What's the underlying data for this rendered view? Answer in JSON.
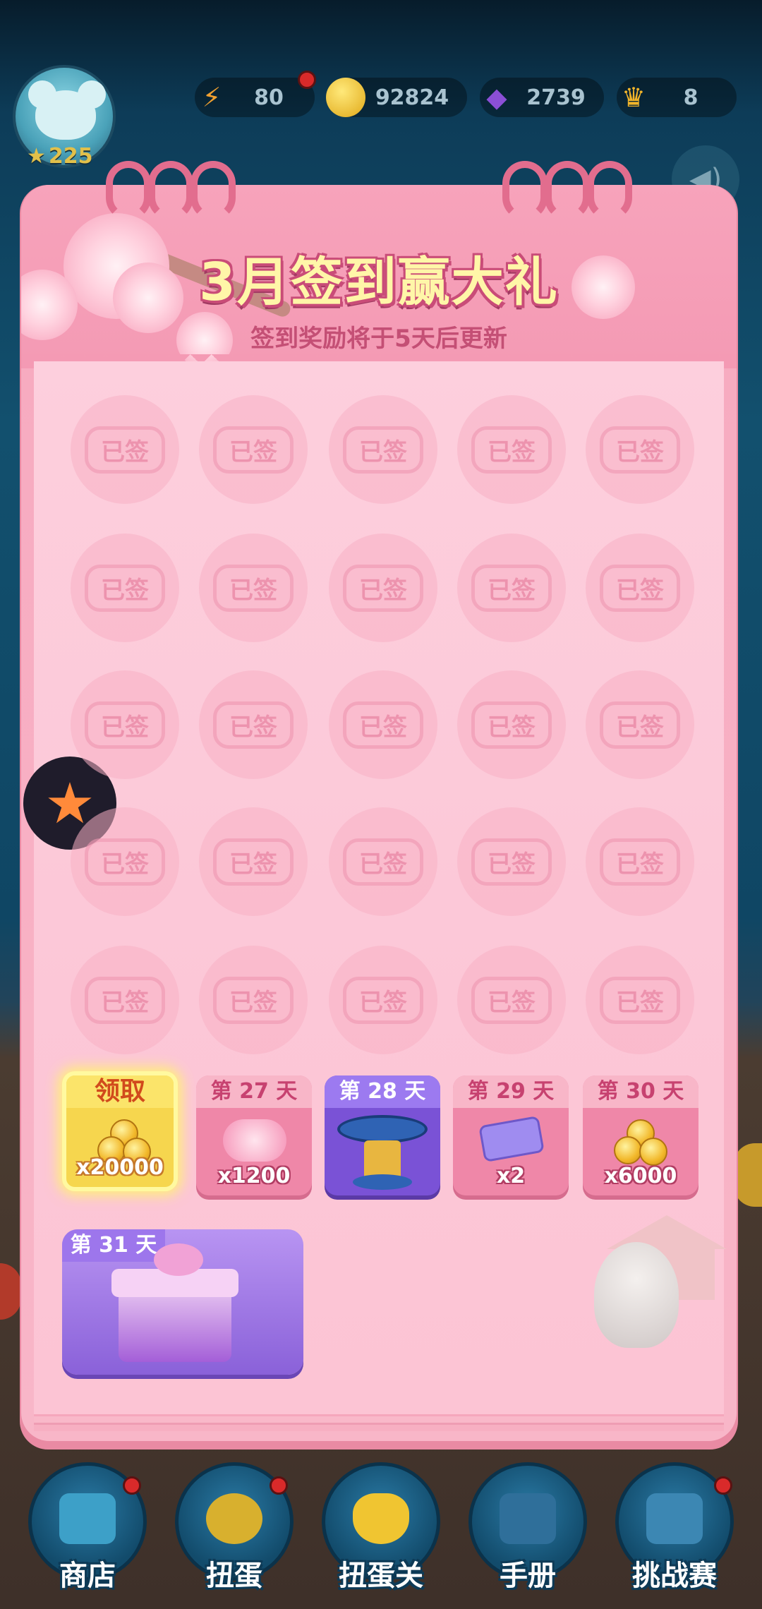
{
  "top_bar": {
    "player_stars": "225",
    "energy": "80",
    "coins": "92824",
    "gems": "2739",
    "crowns": "8"
  },
  "calendar": {
    "title": "3月签到赢大礼",
    "subtitle": "签到奖励将于5天后更新",
    "signed_label": "已签",
    "rewards": [
      {
        "label": "领取",
        "amount": "x20000",
        "icon": "coin-pile-icon"
      },
      {
        "label": "第 27 天",
        "amount": "x1200",
        "icon": "pink-cloud-icon"
      },
      {
        "label": "第 28 天",
        "amount": "",
        "icon": "pedestal-icon"
      },
      {
        "label": "第 29 天",
        "amount": "x2",
        "icon": "ticket-icon"
      },
      {
        "label": "第 30 天",
        "amount": "x6000",
        "icon": "coin-pile-icon"
      }
    ],
    "final_reward": {
      "label": "第 31 天",
      "icon": "gift-box-icon"
    }
  },
  "bottom_nav": [
    {
      "label": "商店",
      "icon": "shop-icon"
    },
    {
      "label": "扭蛋",
      "icon": "gacha-icon"
    },
    {
      "label": "扭蛋关",
      "icon": "gacha-level-icon"
    },
    {
      "label": "手册",
      "icon": "handbook-icon"
    },
    {
      "label": "挑战赛",
      "icon": "challenge-icon"
    }
  ],
  "colors": {
    "accent_pink": "#f7a9bf",
    "title_yellow": "#fff6a8",
    "claim_gold": "#f6d64e",
    "purple": "#8a61d9"
  }
}
